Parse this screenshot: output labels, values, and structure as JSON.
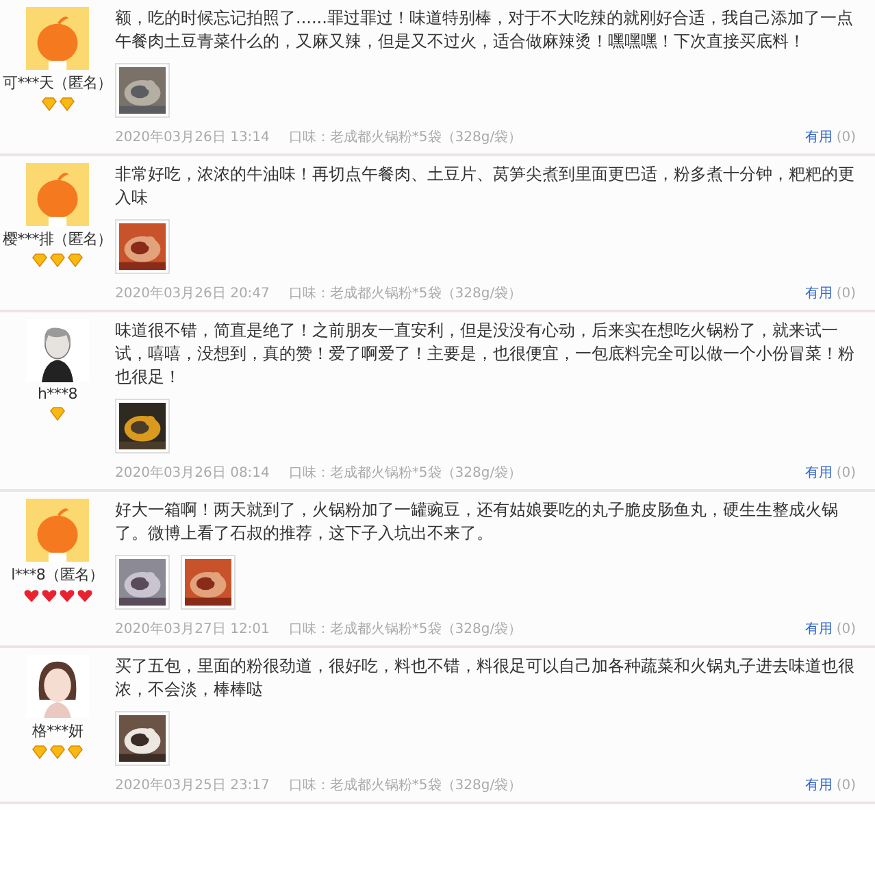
{
  "reviews": [
    {
      "user": "可***天（匿名）",
      "avatar": {
        "kind": "mascot"
      },
      "badges": [
        {
          "kind": "diamond"
        },
        {
          "kind": "diamond"
        }
      ],
      "text": "额，吃的时候忘记拍照了......罪过罪过！味道特别棒，对于不大吃辣的就刚好合适，我自己添加了一点午餐肉土豆青菜什么的，又麻又辣，但是又不过火，适合做麻辣烫！嘿嘿嘿！下次直接买底料！",
      "photos": [
        {
          "kind": "picture"
        }
      ],
      "date": "2020年03月26日 13:14",
      "flavor": "口味：老成都火锅粉*5袋（328g/袋）",
      "useful": "有用",
      "useful_count": "(0)"
    },
    {
      "user": "樱***排（匿名）",
      "avatar": {
        "kind": "mascot"
      },
      "badges": [
        {
          "kind": "diamond"
        },
        {
          "kind": "diamond"
        },
        {
          "kind": "diamond"
        }
      ],
      "text": "非常好吃，浓浓的牛油味！再切点午餐肉、土豆片、莴笋尖煮到里面更巴适，粉多煮十分钟，粑粑的更入味",
      "photos": [
        {
          "kind": "picture"
        }
      ],
      "date": "2020年03月26日 20:47",
      "flavor": "口味：老成都火锅粉*5袋（328g/袋）",
      "useful": "有用",
      "useful_count": "(0)"
    },
    {
      "user": "h***8",
      "avatar": {
        "kind": "sketch"
      },
      "badges": [
        {
          "kind": "diamond"
        }
      ],
      "text": "味道很不错，简直是绝了！之前朋友一直安利，但是没没有心动，后来实在想吃火锅粉了，就来试一试，嘻嘻，没想到，真的赞！爱了啊爱了！主要是，也很便宜，一包底料完全可以做一个小份冒菜！粉也很足！",
      "photos": [
        {
          "kind": "picture"
        }
      ],
      "date": "2020年03月26日 08:14",
      "flavor": "口味：老成都火锅粉*5袋（328g/袋）",
      "useful": "有用",
      "useful_count": "(0)"
    },
    {
      "user": "l***8（匿名）",
      "avatar": {
        "kind": "mascot"
      },
      "badges": [
        {
          "kind": "heart"
        },
        {
          "kind": "heart"
        },
        {
          "kind": "heart"
        },
        {
          "kind": "heart"
        }
      ],
      "text": "好大一箱啊！两天就到了，火锅粉加了一罐豌豆，还有姑娘要吃的丸子脆皮肠鱼丸，硬生生整成火锅了。微博上看了石叔的推荐，这下子入坑出不来了。",
      "photos": [
        {
          "kind": "picture"
        },
        {
          "kind": "picture"
        }
      ],
      "date": "2020年03月27日 12:01",
      "flavor": "口味：老成都火锅粉*5袋（328g/袋）",
      "useful": "有用",
      "useful_count": "(0)"
    },
    {
      "user": "格***妍",
      "avatar": {
        "kind": "girl"
      },
      "badges": [
        {
          "kind": "diamond"
        },
        {
          "kind": "diamond"
        },
        {
          "kind": "diamond"
        }
      ],
      "text": "买了五包，里面的粉很劲道，很好吃，料也不错，料很足可以自己加各种蔬菜和火锅丸子进去味道也很浓，不会淡，棒棒哒",
      "photos": [
        {
          "kind": "picture"
        }
      ],
      "date": "2020年03月25日 23:17",
      "flavor": "口味：老成都火锅粉*5袋（328g/袋）",
      "useful": "有用",
      "useful_count": "(0)"
    }
  ]
}
